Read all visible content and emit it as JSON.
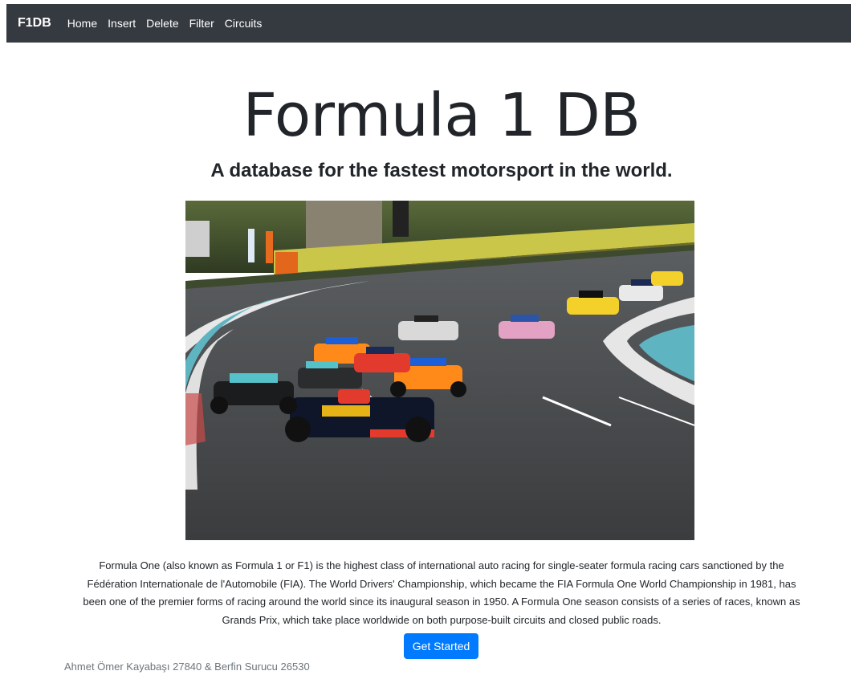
{
  "navbar": {
    "brand": "F1DB",
    "links": [
      "Home",
      "Insert",
      "Delete",
      "Filter",
      "Circuits"
    ]
  },
  "hero": {
    "title": "Formula 1 DB",
    "subtitle": "A database for the fastest motorsport in the world."
  },
  "description": "Formula One (also known as Formula 1 or F1) is the highest class of international auto racing for single-seater formula racing cars sanctioned by the Fédération Internationale de l'Automobile (FIA). The World Drivers' Championship, which became the FIA Formula One World Championship in 1981, has been one of the premier forms of racing around the world since its inaugural season in 1950. A Formula One season consists of a series of races, known as Grands Prix, which take place worldwide on both purpose-built circuits and closed public roads.",
  "cta_label": "Get Started",
  "footer": {
    "credits": "Ahmet Ömer Kayabaşı 27840 & Berfin Surucu 26530"
  },
  "colors": {
    "navbar_bg": "#343a40",
    "button_primary": "#007bff",
    "muted_text": "#6c757d"
  }
}
